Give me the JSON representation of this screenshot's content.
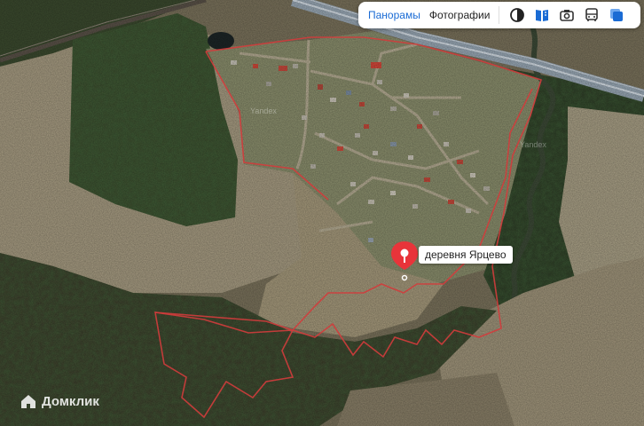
{
  "toolbar": {
    "tabs": [
      {
        "label": "Панорамы",
        "active": true
      },
      {
        "label": "Фотографии",
        "active": false
      }
    ],
    "tools": [
      "layers-icon",
      "book-icon",
      "camera-icon",
      "bus-icon",
      "stack-icon"
    ]
  },
  "placemark": {
    "label": "деревня Ярцево",
    "color": "#e8343a"
  },
  "watermark": {
    "brand": "Домклик",
    "map_text": "Yandex"
  },
  "colors": {
    "boundary": "#d23c3c",
    "accent": "#1a6bd4",
    "road": "#a9b9c9"
  }
}
